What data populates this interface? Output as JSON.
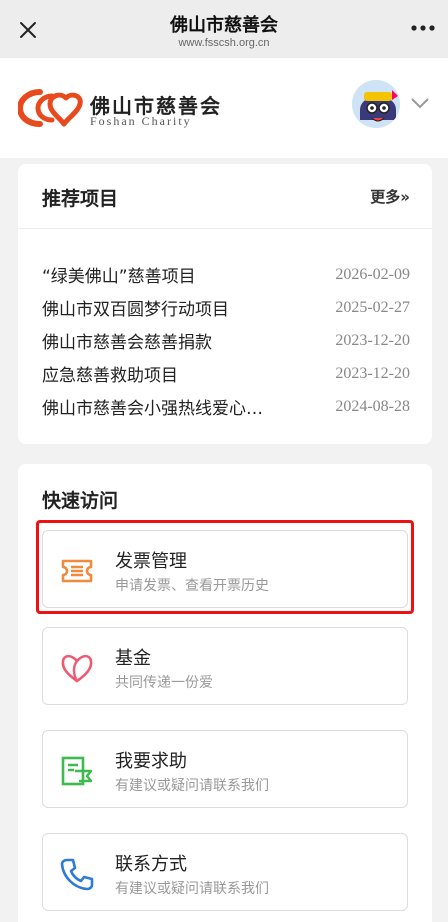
{
  "topbar": {
    "title": "佛山市慈善会",
    "url": "www.fsscsh.org.cn",
    "close_icon": "close-icon",
    "more_icon": "more-dots-icon"
  },
  "header": {
    "brand_cn": "佛山市慈善会",
    "brand_en": "Foshan Charity",
    "logo_color": "#e8491d"
  },
  "recommended": {
    "title": "推荐项目",
    "more_label": "更多»",
    "items": [
      {
        "name": "“绿美佛山”慈善项目",
        "date": "2026-02-09"
      },
      {
        "name": "佛山市双百圆梦行动项目",
        "date": "2025-02-27"
      },
      {
        "name": "佛山市慈善会慈善捐款",
        "date": "2023-12-20"
      },
      {
        "name": "应急慈善救助项目",
        "date": "2023-12-20"
      },
      {
        "name": "佛山市慈善会小强热线爱心…",
        "date": "2024-08-28"
      }
    ]
  },
  "quick_access": {
    "title": "快速访问",
    "items": [
      {
        "title": "发票管理",
        "subtitle": "申请发票、查看开票历史",
        "icon": "invoice-icon",
        "color": "#f08a3c"
      },
      {
        "title": "基金",
        "subtitle": "共同传递一份爱",
        "icon": "heart-icon",
        "color": "#ee5a72"
      },
      {
        "title": "我要求助",
        "subtitle": "有建议或疑问请联系我们",
        "icon": "help-flag-icon",
        "color": "#3dbb4f"
      },
      {
        "title": "联系方式",
        "subtitle": "有建议或疑问请联系我们",
        "icon": "phone-icon",
        "color": "#2e7bd6"
      }
    ]
  }
}
